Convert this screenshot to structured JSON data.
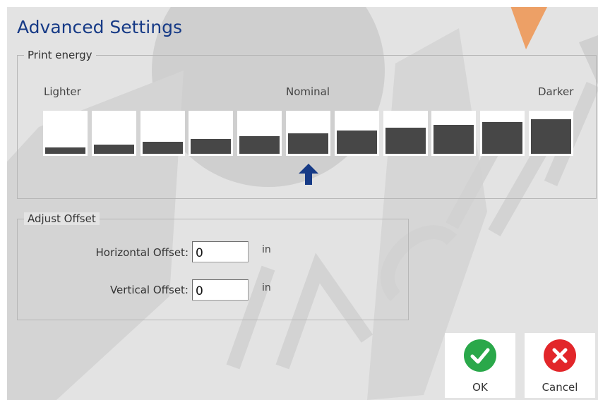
{
  "dialog": {
    "title": "Advanced Settings"
  },
  "print_energy": {
    "legend": "Print energy",
    "scale_labels": {
      "lighter": "Lighter",
      "nominal": "Nominal",
      "darker": "Darker"
    },
    "levels": [
      1,
      2,
      3,
      4,
      5,
      6,
      7,
      8,
      9,
      10,
      11
    ],
    "selected_level": 6,
    "selected_icon": "up-arrow-icon"
  },
  "adjust_offset": {
    "legend": "Adjust Offset",
    "horizontal": {
      "label": "Horizontal Offset:",
      "value": "0",
      "unit": "in"
    },
    "vertical": {
      "label": "Vertical Offset:",
      "value": "0",
      "unit": "in"
    }
  },
  "buttons": {
    "ok": {
      "label": "OK",
      "icon": "checkmark-icon",
      "color": "#2aa84a"
    },
    "cancel": {
      "label": "Cancel",
      "icon": "close-icon",
      "color": "#e2262a"
    }
  },
  "colors": {
    "title": "#163a86",
    "bar_fill": "#474747",
    "arrow": "#163a86",
    "background": "#e3e3e3",
    "watermark_gray": "#c9c9c9",
    "watermark_orange": "#f08a3c"
  }
}
